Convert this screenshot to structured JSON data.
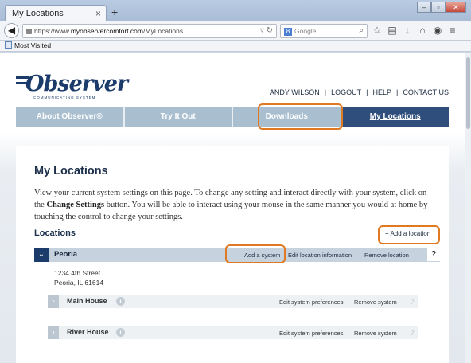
{
  "browser": {
    "tab_title": "My Locations",
    "tab_close": "×",
    "new_tab": "+",
    "url_prefix": "https://www.",
    "url_host": "myobservercomfort.com",
    "url_path": "/MyLocations",
    "search_placeholder": "Google",
    "bookmark_label": "Most Visited"
  },
  "site": {
    "logo_text": "Observer",
    "logo_tagline": "COMMUNICATING SYSTEM",
    "user_nav": [
      "ANDY WILSON",
      "LOGOUT",
      "HELP",
      "CONTACT US"
    ],
    "main_nav": [
      "About Observer®",
      "Try It Out",
      "Downloads",
      "My Locations"
    ],
    "active_nav": "My Locations"
  },
  "page": {
    "title": "My Locations",
    "intro_part1": "View your current system settings on this page. To change any setting and interact directly with your system, click on the ",
    "intro_bold": "Change Settings",
    "intro_part2": " button. You will be able to interact using your mouse in the same manner you would at home by touching the control to change your settings.",
    "locations_heading": "Locations",
    "add_location_label": "+ Add a location"
  },
  "location": {
    "name": "Peoria",
    "add_system_label": "Add a system",
    "edit_label": "Edit location information",
    "remove_label": "Remove location",
    "help_label": "?",
    "address_line1": "1234 4th Street",
    "address_line2": "Peoria, IL 61614"
  },
  "systems": [
    {
      "name": "Main House",
      "edit_label": "Edit system preferences",
      "remove_label": "Remove system",
      "help_label": "?"
    },
    {
      "name": "River House",
      "edit_label": "Edit system preferences",
      "remove_label": "Remove system",
      "help_label": "?"
    }
  ],
  "colors": {
    "highlight": "#e07a22",
    "brand_navy": "#1b3c6b",
    "nav_bg": "#a9bfd0",
    "nav_active": "#2f4e7c"
  }
}
